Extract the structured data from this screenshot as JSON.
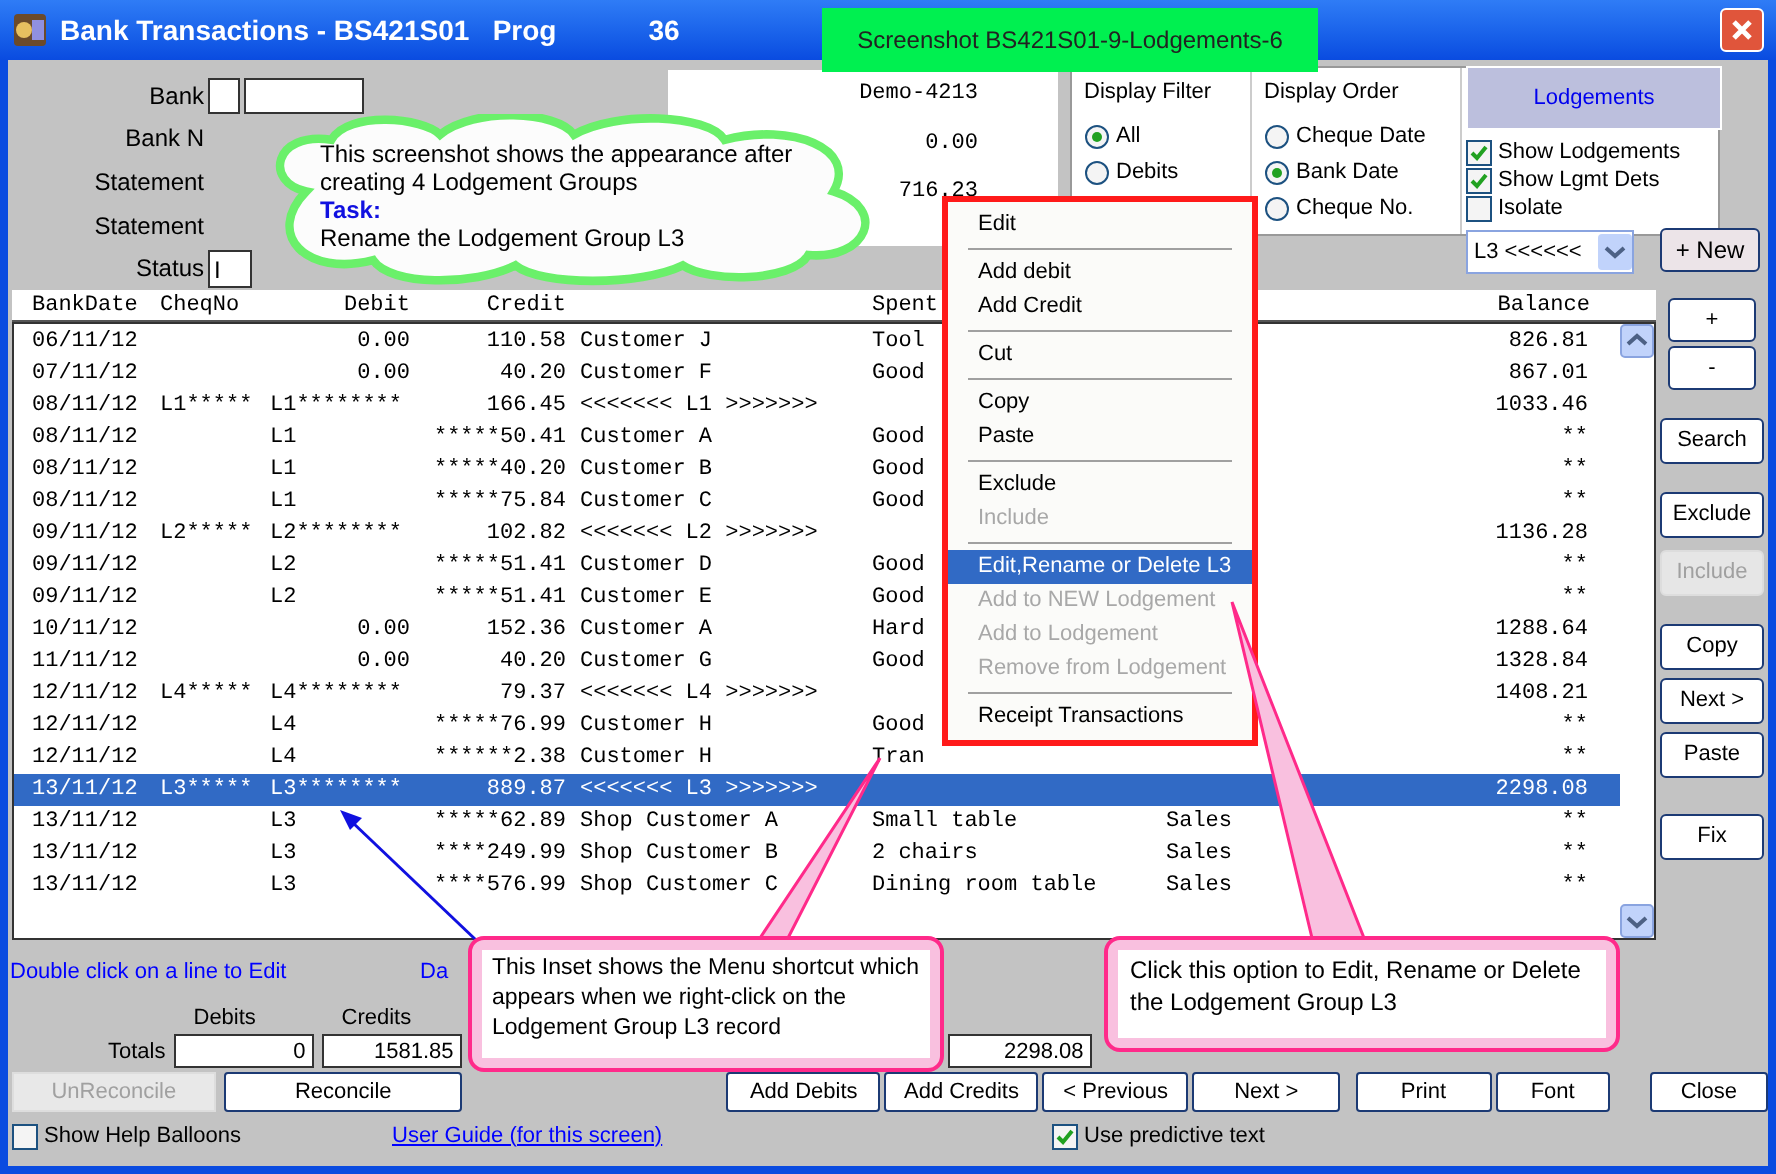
{
  "window": {
    "title": "Bank Transactions - BS421S01   Prog",
    "title_suffix": "36"
  },
  "banner": "Screenshot BS421S01-9-Lodgements-6",
  "cloud": {
    "text": "This screenshot shows the appearance after creating 4 Lodgement Groups",
    "task_label": "Task:",
    "task": "Rename the Lodgement Group L3"
  },
  "header_fields": [
    {
      "label": "Bank",
      "kind": "pair"
    },
    {
      "label": "Bank N",
      "kind": "none"
    },
    {
      "label": "Statement",
      "kind": "none"
    },
    {
      "label": "Statement",
      "kind": "none"
    },
    {
      "label": "Status",
      "kind": "field",
      "value": "I"
    }
  ],
  "account_panel": {
    "name": "Demo-4213",
    "values": [
      "0.00",
      "716.23"
    ]
  },
  "display_filter": {
    "title": "Display Filter",
    "options": [
      {
        "label": "All",
        "selected": true
      },
      {
        "label": "Debits",
        "selected": false
      }
    ]
  },
  "display_order": {
    "title": "Display Order",
    "options": [
      {
        "label": "Cheque Date",
        "selected": false
      },
      {
        "label": "Bank Date",
        "selected": true
      },
      {
        "label": "Cheque No.",
        "selected": false
      }
    ]
  },
  "lodgements": {
    "title": "Lodgements",
    "checks": [
      {
        "label": "Show Lodgements",
        "checked": true
      },
      {
        "label": "Show Lgmt Dets",
        "checked": true
      },
      {
        "label": "Isolate",
        "checked": false
      }
    ],
    "dropdown": "L3 <<<<<<",
    "new_button": "+ New"
  },
  "table": {
    "columns": [
      "BankDate",
      "CheqNo",
      "Debit",
      "Credit",
      "Spent",
      "Balance"
    ],
    "rows": [
      {
        "date": "06/11/12",
        "debit": "0.00",
        "credit": "110.58",
        "desc": "Customer J",
        "spent": "Tool",
        "balance": "826.81",
        "selected": false
      },
      {
        "date": "07/11/12",
        "debit": "0.00",
        "credit": "40.20",
        "desc": "Customer F",
        "spent": "Good",
        "balance": "867.01",
        "selected": false
      },
      {
        "date": "08/11/12",
        "cheq": "L1*****",
        "ref": "L1********",
        "credit": "166.45",
        "desc": "<<<<<<< L1 >>>>>>>",
        "balance": "1033.46",
        "selected": false
      },
      {
        "date": "08/11/12",
        "ref": "L1",
        "credit": "*****50.41",
        "desc": "Customer A",
        "spent": "Good",
        "balance": "**",
        "selected": false
      },
      {
        "date": "08/11/12",
        "ref": "L1",
        "credit": "*****40.20",
        "desc": "Customer B",
        "spent": "Good",
        "balance": "**",
        "selected": false
      },
      {
        "date": "08/11/12",
        "ref": "L1",
        "credit": "*****75.84",
        "desc": "Customer C",
        "spent": "Good",
        "balance": "**",
        "selected": false
      },
      {
        "date": "09/11/12",
        "cheq": "L2*****",
        "ref": "L2********",
        "credit": "102.82",
        "desc": "<<<<<<< L2 >>>>>>>",
        "balance": "1136.28",
        "selected": false
      },
      {
        "date": "09/11/12",
        "ref": "L2",
        "credit": "*****51.41",
        "desc": "Customer D",
        "spent": "Good",
        "balance": "**",
        "selected": false
      },
      {
        "date": "09/11/12",
        "ref": "L2",
        "credit": "*****51.41",
        "desc": "Customer E",
        "spent": "Good",
        "balance": "**",
        "selected": false
      },
      {
        "date": "10/11/12",
        "debit": "0.00",
        "credit": "152.36",
        "desc": "Customer A",
        "spent": "Hard",
        "balance": "1288.64",
        "selected": false
      },
      {
        "date": "11/11/12",
        "debit": "0.00",
        "credit": "40.20",
        "desc": "Customer G",
        "spent": "Good",
        "balance": "1328.84",
        "selected": false
      },
      {
        "date": "12/11/12",
        "cheq": "L4*****",
        "ref": "L4********",
        "credit": "79.37",
        "desc": "<<<<<<< L4 >>>>>>>",
        "balance": "1408.21",
        "selected": false
      },
      {
        "date": "12/11/12",
        "ref": "L4",
        "credit": "*****76.99",
        "desc": "Customer H",
        "spent": "Good",
        "balance": "**",
        "selected": false
      },
      {
        "date": "12/11/12",
        "ref": "L4",
        "credit": "******2.38",
        "desc": "Customer H",
        "spent": "Tran",
        "balance": "**",
        "selected": false
      },
      {
        "date": "13/11/12",
        "cheq": "L3*****",
        "ref": "L3********",
        "credit": "889.87",
        "desc": "<<<<<<< L3 >>>>>>>",
        "balance": "2298.08",
        "selected": true
      },
      {
        "date": "13/11/12",
        "ref": "L3",
        "credit": "*****62.89",
        "desc": "Shop Customer A",
        "spent": "Small table",
        "category": "Sales",
        "balance": "**",
        "selected": false
      },
      {
        "date": "13/11/12",
        "ref": "L3",
        "credit": "****249.99",
        "desc": "Shop Customer B",
        "spent": "2 chairs",
        "category": "Sales",
        "balance": "**",
        "selected": false
      },
      {
        "date": "13/11/12",
        "ref": "L3",
        "credit": "****576.99",
        "desc": "Shop Customer C",
        "spent": "Dining room table",
        "category": "Sales",
        "balance": "**",
        "selected": false
      }
    ]
  },
  "side_buttons": [
    {
      "label": "+",
      "disabled": false
    },
    {
      "label": "-",
      "disabled": false
    },
    {
      "label": "Search",
      "disabled": false
    },
    {
      "label": "Exclude",
      "disabled": false
    },
    {
      "label": "Include",
      "disabled": true
    },
    {
      "label": "Copy",
      "disabled": false
    },
    {
      "label": "Next >",
      "disabled": false
    },
    {
      "label": "Paste",
      "disabled": false
    },
    {
      "label": "Fix",
      "disabled": false
    }
  ],
  "context_menu": [
    {
      "kind": "item",
      "label": "Edit",
      "disabled": false,
      "selected": false
    },
    {
      "kind": "separator"
    },
    {
      "kind": "item",
      "label": "Add debit",
      "disabled": false,
      "selected": false
    },
    {
      "kind": "item",
      "label": "Add Credit",
      "disabled": false,
      "selected": false
    },
    {
      "kind": "separator"
    },
    {
      "kind": "item",
      "label": "Cut",
      "disabled": false,
      "selected": false
    },
    {
      "kind": "separator"
    },
    {
      "kind": "item",
      "label": "Copy",
      "disabled": false,
      "selected": false
    },
    {
      "kind": "item",
      "label": "Paste",
      "disabled": false,
      "selected": false
    },
    {
      "kind": "separator"
    },
    {
      "kind": "item",
      "label": "Exclude",
      "disabled": false,
      "selected": false
    },
    {
      "kind": "item",
      "label": "Include",
      "disabled": true,
      "selected": false
    },
    {
      "kind": "separator"
    },
    {
      "kind": "item",
      "label": "Edit,Rename or Delete L3",
      "disabled": false,
      "selected": true
    },
    {
      "kind": "item",
      "label": "Add to NEW Lodgement",
      "disabled": true,
      "selected": false
    },
    {
      "kind": "item",
      "label": "Add to Lodgement",
      "disabled": true,
      "selected": false
    },
    {
      "kind": "item",
      "label": "Remove from Lodgement",
      "disabled": true,
      "selected": false
    },
    {
      "kind": "separator"
    },
    {
      "kind": "item",
      "label": "Receipt Transactions",
      "disabled": false,
      "selected": false
    }
  ],
  "footer": {
    "hint": "Double click on a line to Edit",
    "hint_2": "Da",
    "debits_label": "Debits",
    "credits_label": "Credits",
    "totals_label": "Totals",
    "debits": "0",
    "credits": "1581.85",
    "balance": "2298.08",
    "buttons": [
      {
        "label": "UnReconcile",
        "disabled": true
      },
      {
        "label": "Reconcile",
        "disabled": false
      },
      {
        "label": "Add Debits",
        "disabled": false
      },
      {
        "label": "Add Credits",
        "disabled": false
      },
      {
        "label": "< Previous",
        "disabled": false
      },
      {
        "label": "Next >",
        "disabled": false
      },
      {
        "label": "Print",
        "disabled": false
      },
      {
        "label": "Font",
        "disabled": false
      },
      {
        "label": "Close",
        "disabled": false
      }
    ],
    "help_balloons": {
      "label": "Show Help Balloons",
      "checked": false
    },
    "link": "User Guide (for this screen)",
    "predictive": {
      "label": "Use predictive text",
      "checked": true
    }
  },
  "callouts": [
    {
      "text": "This Inset shows the Menu shortcut which appears when we right-click on the Lodgement Group L3 record"
    },
    {
      "text": "Click this option to Edit, Rename or Delete the Lodgement Group L3"
    }
  ]
}
